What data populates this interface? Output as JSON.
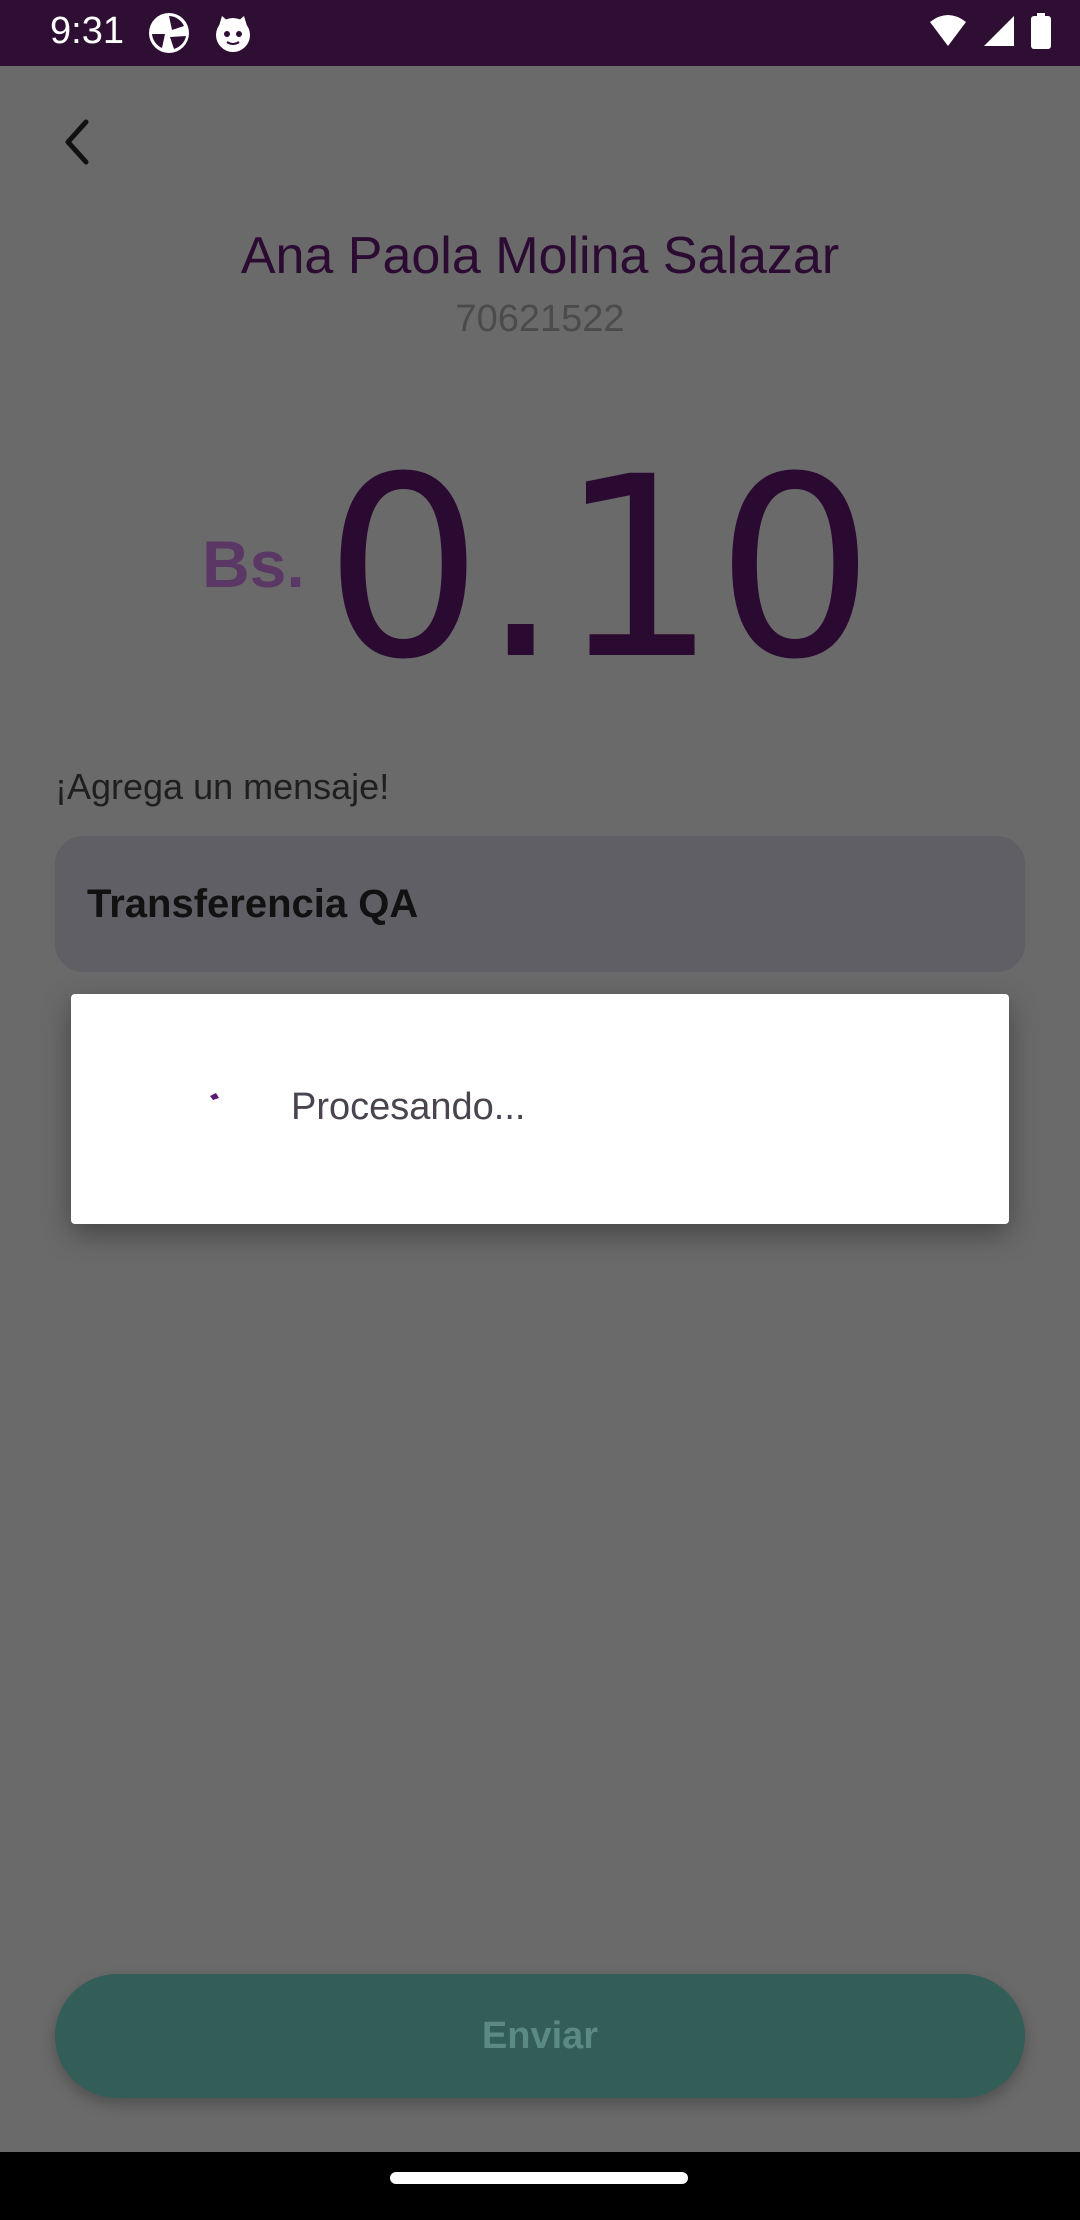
{
  "status_bar": {
    "time": "9:31",
    "app_icons": [
      "aperture-app-icon",
      "cat-app-icon"
    ],
    "system_icons": [
      "wifi-icon",
      "signal-icon",
      "battery-icon"
    ]
  },
  "header": {
    "back_icon": "chevron-left-icon",
    "recipient_name": "Ana Paola Molina Salazar",
    "recipient_phone": "70621522"
  },
  "amount": {
    "currency": "Bs.",
    "value": "0.10"
  },
  "message": {
    "label": "¡Agrega un mensaje!",
    "value": "Transferencia QA"
  },
  "dialog": {
    "text": "Procesando..."
  },
  "footer": {
    "send_label": "Enviar"
  },
  "colors": {
    "status_bar": "#2e0e33",
    "accent_purple": "#2c0b33",
    "send_button": "#335d57"
  }
}
